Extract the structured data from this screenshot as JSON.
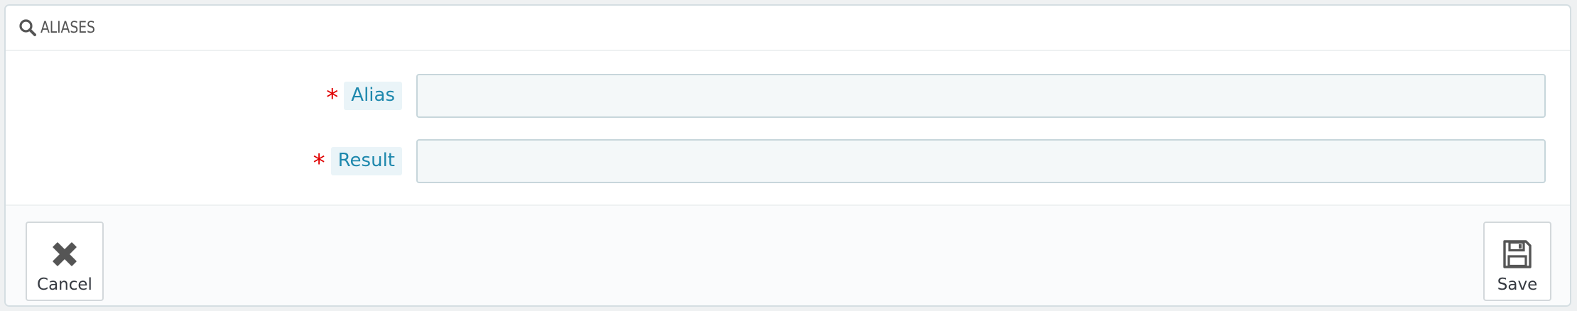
{
  "panel": {
    "title": "ALIASES",
    "title_icon": "search-icon"
  },
  "form": {
    "fields": [
      {
        "label": "Alias",
        "required_marker": "*",
        "value": "",
        "placeholder": ""
      },
      {
        "label": "Result",
        "required_marker": "*",
        "value": "",
        "placeholder": ""
      }
    ]
  },
  "footer": {
    "cancel": {
      "label": "Cancel",
      "icon": "close-icon"
    },
    "save": {
      "label": "Save",
      "icon": "floppy-disk-icon"
    }
  },
  "colors": {
    "label_text": "#1e88ad",
    "label_bg": "#eaf4f8",
    "required": "#e00000",
    "input_bg": "#f4f8f9",
    "input_border": "#c7d6db"
  }
}
